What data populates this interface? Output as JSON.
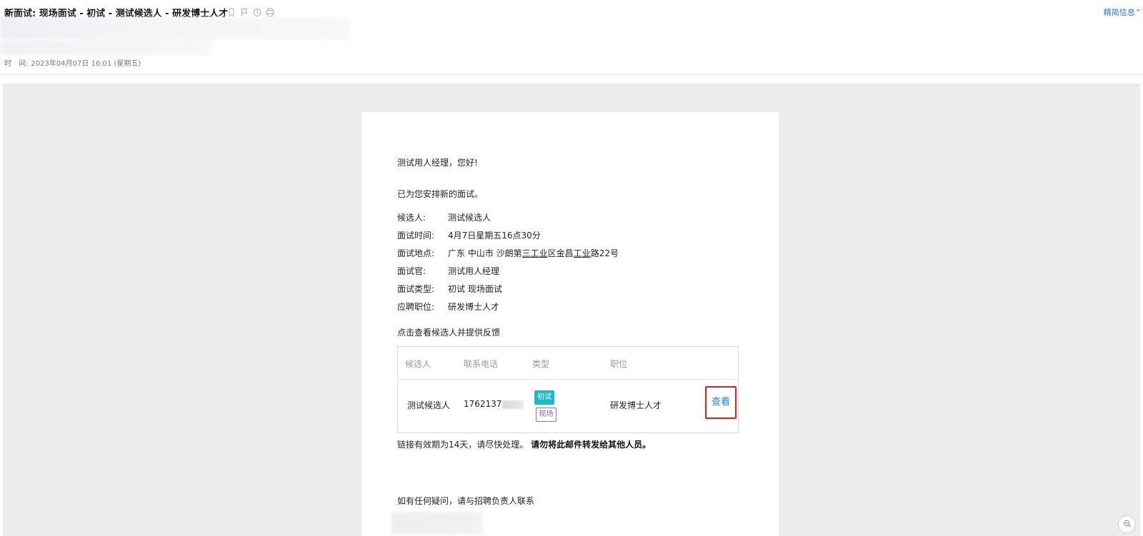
{
  "header": {
    "subject": "新面试: 现场面试 - 初试 - 测试候选人 - 研发博士人才",
    "brief_link": "精简信息",
    "brief_chevron": "⌃",
    "time_label": "时　间:",
    "time_value": "2023年04月07日 16:01 (星期五)",
    "icons": [
      "bookmark-icon",
      "flag-icon",
      "clock-icon",
      "print-icon"
    ]
  },
  "email": {
    "greeting_prefix": "测试",
    "greeting_rest": "用人经理，您好!",
    "intro": "已为您安排新的面试。",
    "details": [
      {
        "key": "候选人:",
        "value": "测试候选人"
      },
      {
        "key": "面试时间:",
        "value": "4月7日星期五16点30分"
      },
      {
        "key": "面试地点:",
        "value_parts": [
          "广东 中山市 沙朗第",
          "三工业",
          "区金昌",
          "工业",
          "路22号"
        ]
      },
      {
        "key": "面试官:",
        "value": "测试用人经理"
      },
      {
        "key": "面试类型:",
        "value": "初试 现场面试"
      },
      {
        "key": "应聘职位:",
        "value": "研发博士人才"
      }
    ],
    "click_hint": "点击查看候选人并提供反馈",
    "table": {
      "headers": [
        "候选人",
        "联系电话",
        "类型",
        "职位"
      ],
      "row": {
        "candidate": "测试候选人",
        "phone": "1762137",
        "tag_round": "初试",
        "tag_mode": "现场",
        "position": "研发博士人才",
        "action": "查看"
      }
    },
    "validity_normal": "链接有效期为14天，请尽快处理。",
    "validity_bold": "请勿将此邮件转发给其他人员。",
    "contact": "如有任何疑问，请与招聘负责人联系"
  },
  "colors": {
    "link": "#2b6fd1",
    "tag_first_bg": "#1bb8c9",
    "tag_onsite": "#8a5ccf",
    "highlight_border": "#e02020",
    "body_bg": "#ececec"
  }
}
